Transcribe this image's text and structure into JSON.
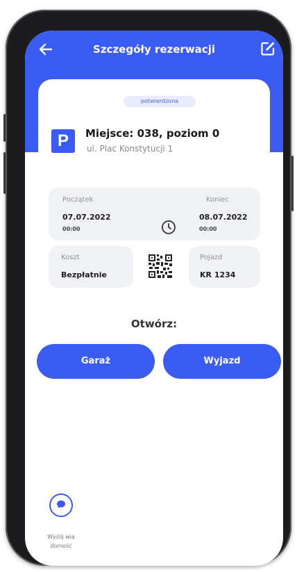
{
  "header": {
    "title": "Szczegóły rezerwacji",
    "back_icon": "arrow-left-icon",
    "edit_icon": "edit-icon"
  },
  "reservation": {
    "status": "potwierdzona",
    "place_title": "Miejsce: 038, poziom 0",
    "address": "ul. Plac Konstytucji 1",
    "parking_icon_letter": "P"
  },
  "period": {
    "start_label": "Początek",
    "start_date": "07.07.2022",
    "start_time": "00:00",
    "end_label": "Koniec",
    "end_date": "08.07.2022",
    "end_time": "00:00"
  },
  "details": {
    "cost_label": "Koszt",
    "cost_value": "Bezpłatnie",
    "vehicle_label": "Pojazd",
    "vehicle_value": "KR 1234"
  },
  "open": {
    "title": "Otwórz:",
    "garage_button": "Garaż",
    "exit_button": "Wyjazd"
  },
  "message": {
    "label_line1": "Wyślij wia",
    "label_line2": "domość"
  },
  "colors": {
    "accent": "#3a5cf3",
    "box_bg": "#f1f2f5",
    "badge_bg": "#e7ecff"
  }
}
